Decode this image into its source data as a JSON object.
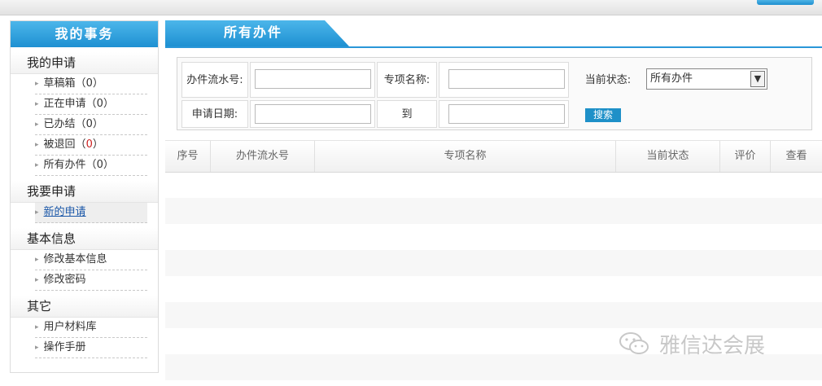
{
  "sidebar": {
    "title": "我的事务",
    "sections": [
      {
        "title": "我的申请",
        "items": [
          {
            "label": "草稿箱",
            "count": "0"
          },
          {
            "label": "正在申请",
            "count": "0"
          },
          {
            "label": "已办结",
            "count": "0"
          },
          {
            "label": "被退回",
            "count": "0"
          },
          {
            "label": "所有办件",
            "count": "0"
          }
        ]
      },
      {
        "title": "我要申请",
        "items": [
          {
            "label": "新的申请"
          }
        ]
      },
      {
        "title": "基本信息",
        "items": [
          {
            "label": "修改基本信息"
          },
          {
            "label": "修改密码"
          }
        ]
      },
      {
        "title": "其它",
        "items": [
          {
            "label": "用户材料库"
          },
          {
            "label": "操作手册"
          }
        ]
      }
    ]
  },
  "main": {
    "tab_title": "所有办件",
    "search": {
      "serial_label": "办件流水号:",
      "serial_value": "",
      "project_label": "专项名称:",
      "project_value": "",
      "status_label": "当前状态:",
      "status_selected": "所有办件",
      "date_label": "申请日期:",
      "date_from": "",
      "date_to_label": "到",
      "date_to": "",
      "search_button": "搜索"
    },
    "table": {
      "columns": [
        "序号",
        "办件流水号",
        "专项名称",
        "当前状态",
        "评价",
        "查看"
      ]
    }
  },
  "watermark": "雅信达会展",
  "colors": {
    "accent": "#1e90d2",
    "count_red": "#cc2222",
    "link_blue": "#1a57a8"
  }
}
